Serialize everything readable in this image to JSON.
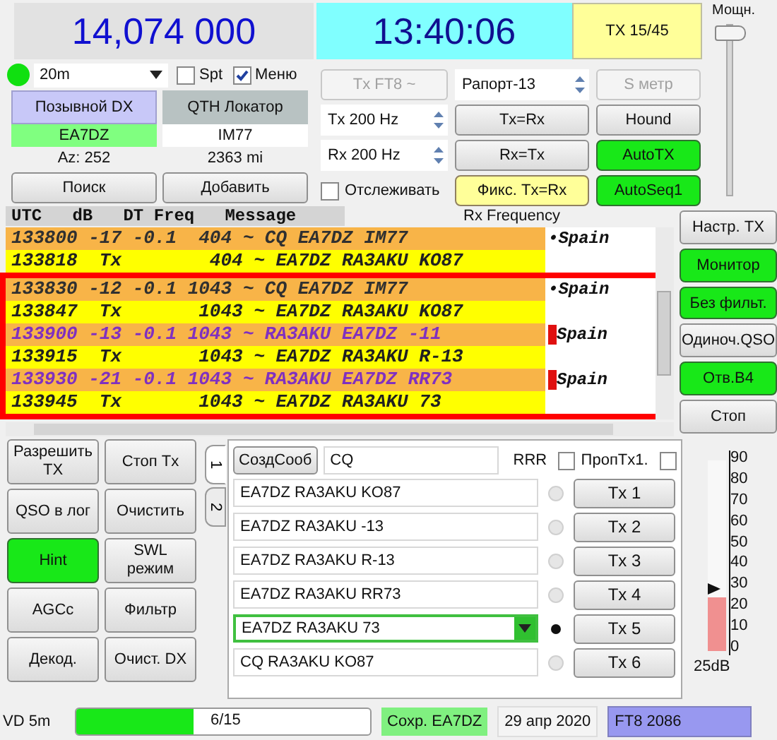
{
  "frequency": "14,074 000",
  "clock": "13:40:06",
  "tx_status": "TX 15/45",
  "power": {
    "label": "Мощн.",
    "level": 1
  },
  "band": {
    "indicator_on": true,
    "value": "20m"
  },
  "spot": {
    "label": "Spt",
    "checked": false
  },
  "menu": {
    "label": "Меню",
    "checked": true
  },
  "dx": {
    "call_label": "Позывной DX",
    "locator_label": "QTH Локатор",
    "call": "EA7DZ",
    "locator": "IM77",
    "azimuth": "Az: 252",
    "distance": "2363 mi"
  },
  "dx_buttons": [
    "Поиск",
    "Добавить"
  ],
  "tx_mode": {
    "label": "Tx FT8 ~",
    "disabled": true
  },
  "tx_freq": "Tx  200  Hz",
  "rx_freq": "Rx  200  Hz",
  "track": {
    "label": "Отслеживать",
    "checked": false
  },
  "report": "Рапорт-13",
  "s_meter": {
    "label": "S метр",
    "disabled": true
  },
  "middle_buttons": [
    {
      "label": "Tx=Rx",
      "on": false
    },
    {
      "label": "Rx=Tx",
      "on": false
    },
    {
      "label": "Фикс. Tx=Rx",
      "kind": "lock",
      "on": true
    }
  ],
  "right_buttons": [
    {
      "label": "Hound",
      "on": false
    },
    {
      "label": "AutoTX",
      "on": true
    },
    {
      "label": "AutoSeq1",
      "on": true
    }
  ],
  "decodes": {
    "header": "UTC   dB   DT Freq   Message",
    "rx_label": "Rx Frequency",
    "rows": [
      {
        "kind": "cq",
        "line": "133800 -17 -0.1  404 ~ CQ EA7DZ IM77",
        "country": "•Spain",
        "flag": false,
        "highlighted": false
      },
      {
        "kind": "tx",
        "line": "133818  Tx        404 ~ EA7DZ RA3AKU KO87",
        "highlighted": false
      },
      {
        "kind": "cq",
        "line": "133830 -12 -0.1 1043 ~ CQ EA7DZ IM77",
        "country": "•Spain",
        "flag": false,
        "highlighted": true
      },
      {
        "kind": "tx",
        "line": "133847  Tx       1043 ~ EA7DZ RA3AKU KO87",
        "highlighted": true
      },
      {
        "kind": "reply",
        "line": "133900 -13 -0.1 1043 ~ RA3AKU EA7DZ -11",
        "country": "Spain",
        "flag": true,
        "highlighted": true
      },
      {
        "kind": "tx",
        "line": "133915  Tx       1043 ~ EA7DZ RA3AKU R-13",
        "highlighted": true
      },
      {
        "kind": "reply",
        "line": "133930 -21 -0.1 1043 ~ RA3AKU EA7DZ RR73",
        "country": "Spain",
        "flag": true,
        "highlighted": true
      },
      {
        "kind": "tx",
        "line": "133945  Tx       1043 ~ EA7DZ RA3AKU 73",
        "highlighted": true
      }
    ]
  },
  "side_buttons": [
    {
      "label": "Настр. TX",
      "on": false
    },
    {
      "label": "Монитор",
      "on": true
    },
    {
      "label": "Без фильт.",
      "on": true
    },
    {
      "label": "Одиноч.QSO",
      "on": false
    },
    {
      "label": "Отв.B4",
      "on": true
    },
    {
      "label": "Стоп",
      "on": false
    }
  ],
  "action_buttons": [
    {
      "label": "Разрешить TX",
      "on": false
    },
    {
      "label": "QSO в лог",
      "on": false
    },
    {
      "label": "Hint",
      "on": true
    },
    {
      "label": "AGCc",
      "on": false
    },
    {
      "label": "Декод.",
      "on": false
    },
    {
      "label": "Стоп Tx",
      "on": false
    },
    {
      "label": "Очистить",
      "on": false
    },
    {
      "label": "SWL режим",
      "on": false
    },
    {
      "label": "Фильтр",
      "on": false
    },
    {
      "label": "Очист. DX",
      "on": false
    }
  ],
  "tabs": [
    {
      "label": "1",
      "selected": true
    },
    {
      "label": "2",
      "selected": false
    }
  ],
  "messages": {
    "generate_label": "СоздСооб",
    "cq": "CQ",
    "rrr": {
      "label": "RRR",
      "checked": false
    },
    "skip_tx1": {
      "label": "ПропTx1.",
      "checked": false
    },
    "rows": [
      {
        "kind": "field",
        "text": "EA7DZ RA3AKU KO87",
        "button": "Tx 1",
        "selected": false
      },
      {
        "kind": "field",
        "text": "EA7DZ RA3AKU -13",
        "button": "Tx 2",
        "selected": false
      },
      {
        "kind": "field",
        "text": "EA7DZ RA3AKU R-13",
        "button": "Tx 3",
        "selected": false
      },
      {
        "kind": "field",
        "text": "EA7DZ RA3AKU RR73",
        "button": "Tx 4",
        "selected": false
      },
      {
        "kind": "combo",
        "text": "EA7DZ RA3AKU 73",
        "button": "Tx 5",
        "selected": true
      },
      {
        "kind": "field",
        "text": "CQ RA3AKU KO87",
        "button": "Tx 6",
        "selected": false
      }
    ]
  },
  "meter": {
    "scale": [
      "90",
      "80",
      "70",
      "60",
      "50",
      "40",
      "30",
      "20",
      "10",
      "0"
    ],
    "level": 0.28,
    "reading": "25dB"
  },
  "status": {
    "mode_cut": "VD 5m",
    "progress": {
      "text": "6/15",
      "level": 0.4
    },
    "save": "Сохр. EA7DZ",
    "date": "29 апр 2020",
    "mode": "FT8  2086"
  }
}
